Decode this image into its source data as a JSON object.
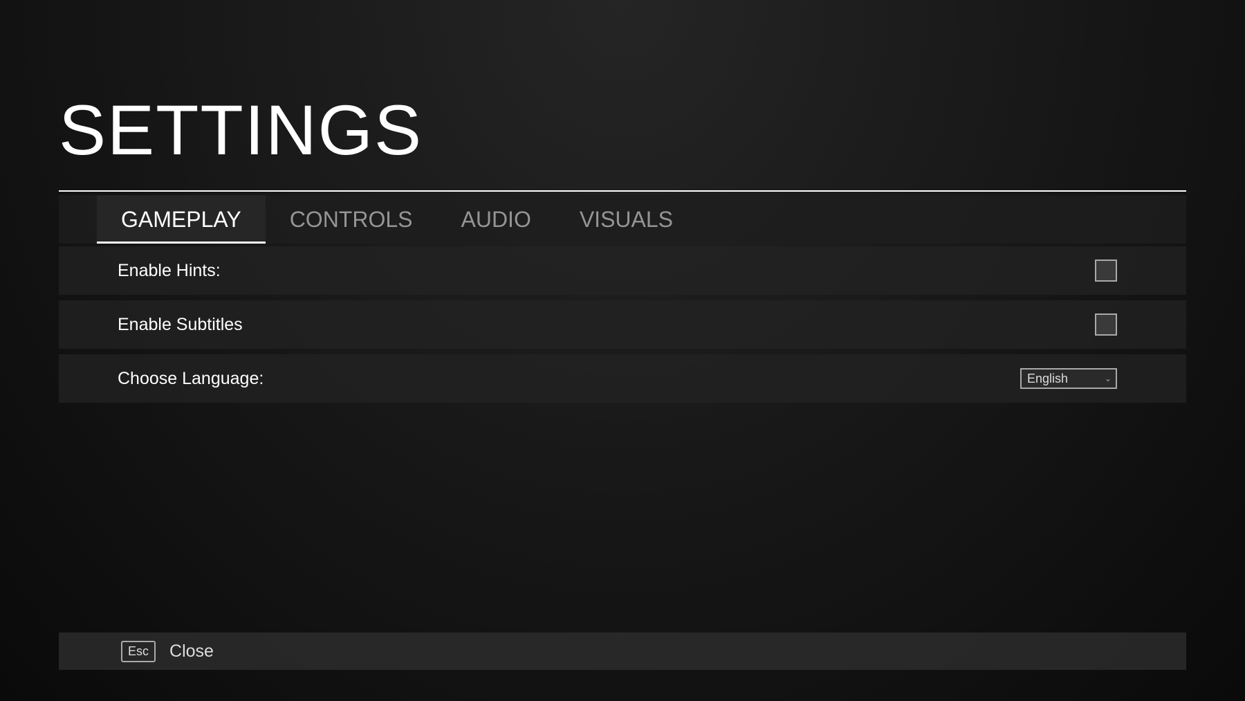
{
  "title": "SETTINGS",
  "tabs": [
    {
      "label": "GAMEPLAY",
      "active": true
    },
    {
      "label": "CONTROLS",
      "active": false
    },
    {
      "label": "AUDIO",
      "active": false
    },
    {
      "label": "VISUALS",
      "active": false
    }
  ],
  "settings": {
    "hints_label": "Enable Hints:",
    "subtitles_label": "Enable Subtitles",
    "language_label": "Choose Language:",
    "language_value": "English"
  },
  "footer": {
    "key": "Esc",
    "action": "Close"
  }
}
